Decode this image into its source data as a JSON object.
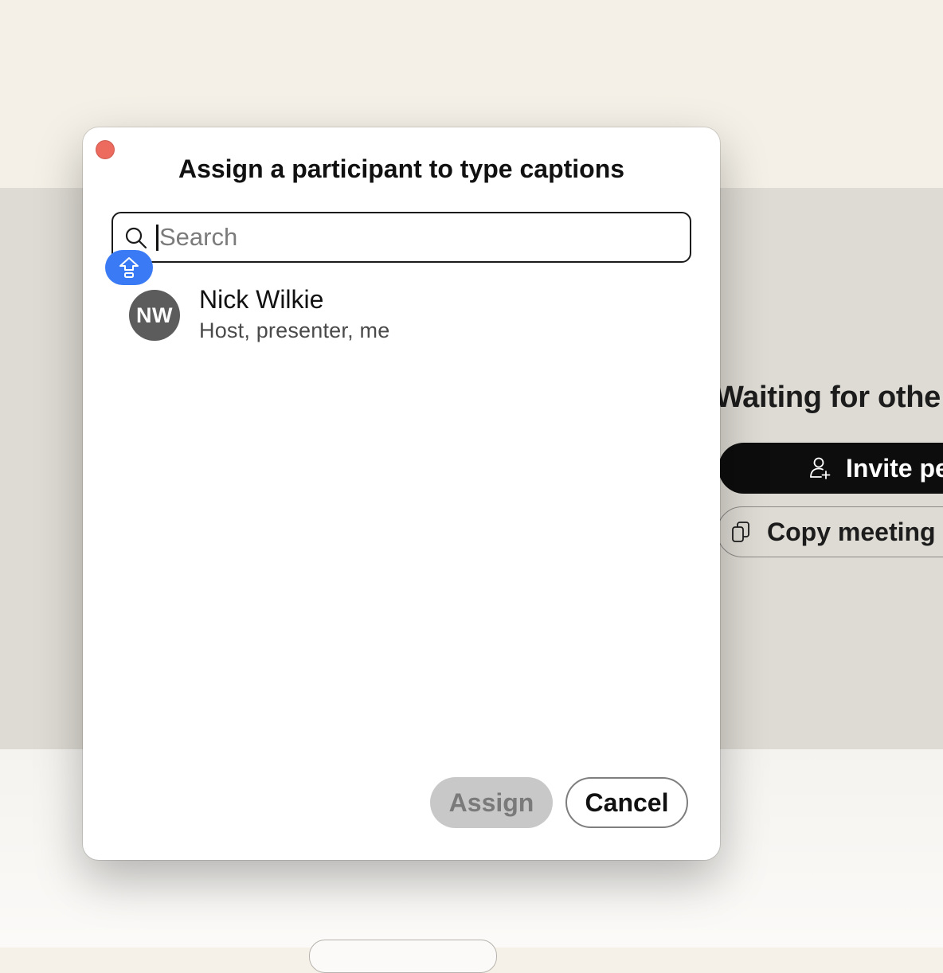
{
  "background": {
    "waiting_text": "Waiting for othe",
    "invite_button_label": "Invite pe",
    "copy_button_label": "Copy meeting i"
  },
  "dialog": {
    "title": "Assign a participant to type captions",
    "search": {
      "placeholder": "Search",
      "value": ""
    },
    "participants": [
      {
        "initials": "NW",
        "name": "Nick Wilkie",
        "role": "Host, presenter, me",
        "icons": [
          "presenter-share-icon"
        ]
      }
    ],
    "buttons": {
      "assign_label": "Assign",
      "assign_enabled": false,
      "cancel_label": "Cancel"
    }
  },
  "colors": {
    "accent": "#3a7bf5",
    "close": "#ec6a5e",
    "avatar": "#5c5c5c",
    "disabled_button": "#c8c8c8"
  }
}
